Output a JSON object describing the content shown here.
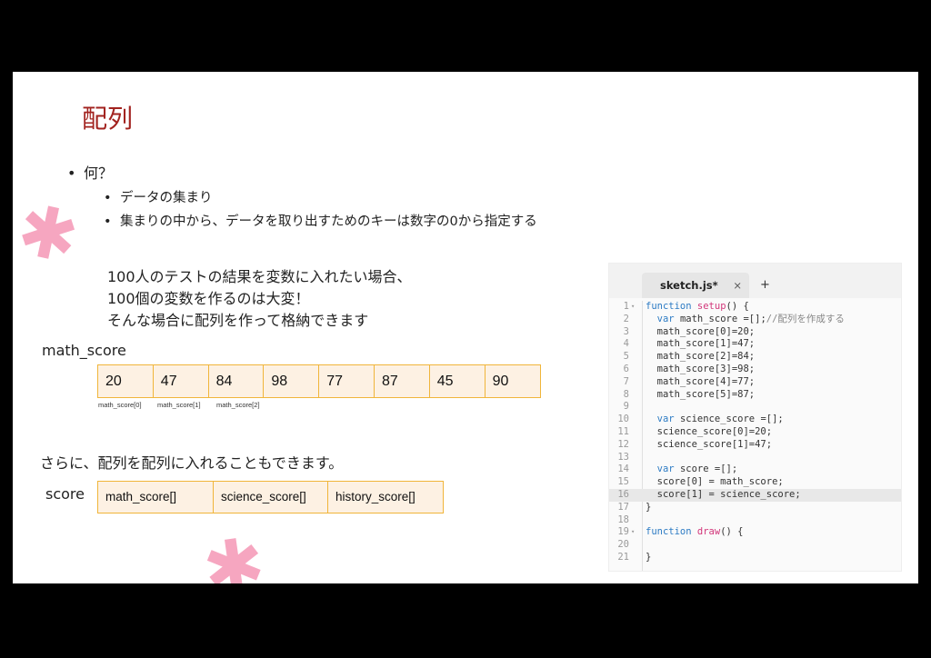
{
  "slide": {
    "title": "配列",
    "bullets": {
      "main": "何？",
      "sub": [
        "データの集まり",
        "集まりの中から、データを取り出すためのキーは数字の0から指定する"
      ]
    },
    "description": [
      "100人のテストの結果を変数に入れたい場合、",
      "100個の変数を作るのは大変！",
      "そんな場合に配列を作って格納できます"
    ],
    "math_score_label": "math_score",
    "math_score_values": [
      "20",
      "47",
      "84",
      "98",
      "77",
      "87",
      "45",
      "90"
    ],
    "index_labels": [
      "math_score[0]",
      "math_score[1]",
      "math_score[2]"
    ],
    "nested_text": "さらに、配列を配列に入れることもできます。",
    "score_label": "score",
    "score_values": [
      "math_score[]",
      "science_score[]",
      "history_score[]"
    ]
  },
  "editor": {
    "tab_name": "sketch.js*",
    "tab_close": "×",
    "new_tab": "+",
    "fold_marker": "▾",
    "highlighted_line": 16,
    "lines": [
      {
        "n": "1",
        "fold": true,
        "parts": [
          [
            "kw",
            "function "
          ],
          [
            "fn",
            "setup"
          ],
          [
            "",
            "() {"
          ]
        ]
      },
      {
        "n": "2",
        "parts": [
          [
            "",
            "  "
          ],
          [
            "kw",
            "var"
          ],
          [
            "",
            " math_score =[];"
          ],
          [
            "cm",
            "//配列を作成する"
          ]
        ]
      },
      {
        "n": "3",
        "parts": [
          [
            "",
            "  math_score[0]=20;"
          ]
        ]
      },
      {
        "n": "4",
        "parts": [
          [
            "",
            "  math_score[1]=47;"
          ]
        ]
      },
      {
        "n": "5",
        "parts": [
          [
            "",
            "  math_score[2]=84;"
          ]
        ]
      },
      {
        "n": "6",
        "parts": [
          [
            "",
            "  math_score[3]=98;"
          ]
        ]
      },
      {
        "n": "7",
        "parts": [
          [
            "",
            "  math_score[4]=77;"
          ]
        ]
      },
      {
        "n": "8",
        "parts": [
          [
            "",
            "  math_score[5]=87;"
          ]
        ]
      },
      {
        "n": "9",
        "parts": []
      },
      {
        "n": "10",
        "parts": [
          [
            "",
            "  "
          ],
          [
            "kw",
            "var"
          ],
          [
            "",
            " science_score =[];"
          ]
        ]
      },
      {
        "n": "11",
        "parts": [
          [
            "",
            "  science_score[0]=20;"
          ]
        ]
      },
      {
        "n": "12",
        "parts": [
          [
            "",
            "  science_score[1]=47;"
          ]
        ]
      },
      {
        "n": "13",
        "parts": []
      },
      {
        "n": "14",
        "parts": [
          [
            "",
            "  "
          ],
          [
            "kw",
            "var"
          ],
          [
            "",
            " score =[];"
          ]
        ]
      },
      {
        "n": "15",
        "parts": [
          [
            "",
            "  score[0] = math_score;"
          ]
        ]
      },
      {
        "n": "16",
        "parts": [
          [
            "",
            "  score[1] = science_score;"
          ]
        ]
      },
      {
        "n": "17",
        "parts": [
          [
            "",
            "}"
          ]
        ]
      },
      {
        "n": "18",
        "parts": []
      },
      {
        "n": "19",
        "fold": true,
        "parts": [
          [
            "kw",
            "function "
          ],
          [
            "fn",
            "draw"
          ],
          [
            "",
            "() {"
          ]
        ]
      },
      {
        "n": "20",
        "parts": []
      },
      {
        "n": "21",
        "parts": [
          [
            "",
            "}"
          ]
        ]
      }
    ]
  },
  "decor": {
    "asterisk_glyph": "✱",
    "color": "#f6a6c0"
  }
}
